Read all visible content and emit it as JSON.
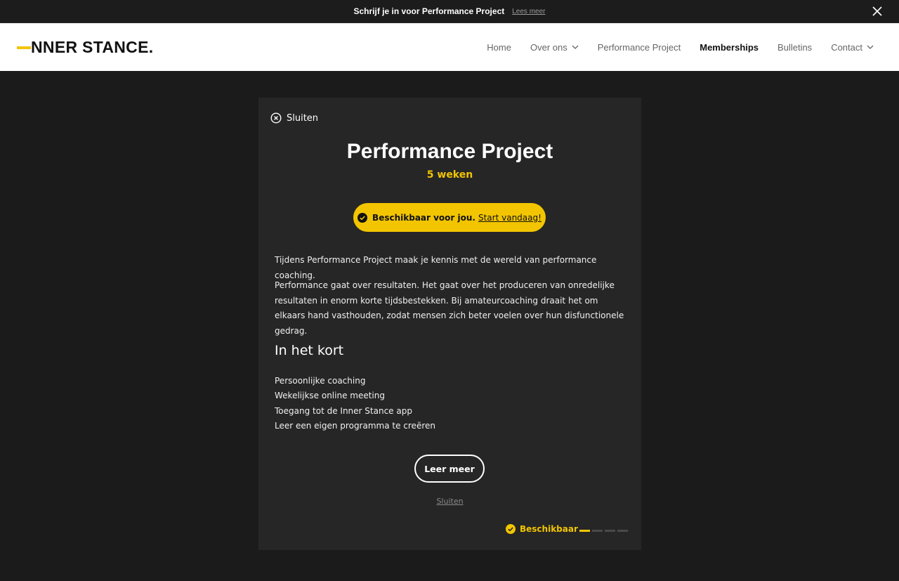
{
  "topbar": {
    "text": "Schrijf je in voor Performance Project",
    "link": "Lees meer",
    "close_icon": "close-icon"
  },
  "header": {
    "logo": "NNER STANCE.",
    "nav": [
      {
        "label": "Home",
        "dropdown": false,
        "active": false
      },
      {
        "label": "Over ons",
        "dropdown": true,
        "active": false
      },
      {
        "label": "Performance Project",
        "dropdown": false,
        "active": false
      },
      {
        "label": "Memberships",
        "dropdown": false,
        "active": true
      },
      {
        "label": "Bulletins",
        "dropdown": false,
        "active": false
      },
      {
        "label": "Contact",
        "dropdown": true,
        "active": false
      }
    ]
  },
  "modal": {
    "close_label": "Sluiten",
    "title": "Performance Project",
    "subtitle": "5 weken",
    "availability": {
      "text": "Beschikbaar voor jou.",
      "link": "Start vandaag!"
    },
    "paragraphs": [
      "Tijdens Performance Project maak je kennis met de wereld van performance coaching.",
      "Performance gaat over resultaten. Het gaat over het produceren van onredelijke resultaten in enorm korte tijdsbestekken. Bij amateurcoaching draait het om elkaars hand vasthouden, zodat mensen zich beter voelen over hun disfunctionele gedrag."
    ],
    "section_title": "In het kort",
    "features": [
      "Persoonlijke coaching",
      "Wekelijkse online meeting",
      "Toegang tot de Inner Stance app",
      "Leer een eigen programma te creëren"
    ],
    "cta_label": "Leer meer",
    "close_link": "Sluiten",
    "status_label": "Beschikbaar",
    "progress": {
      "current": 1,
      "total": 4
    }
  },
  "colors": {
    "accent": "#f2c500",
    "background": "#1b1b1b",
    "panel": "#262626"
  }
}
